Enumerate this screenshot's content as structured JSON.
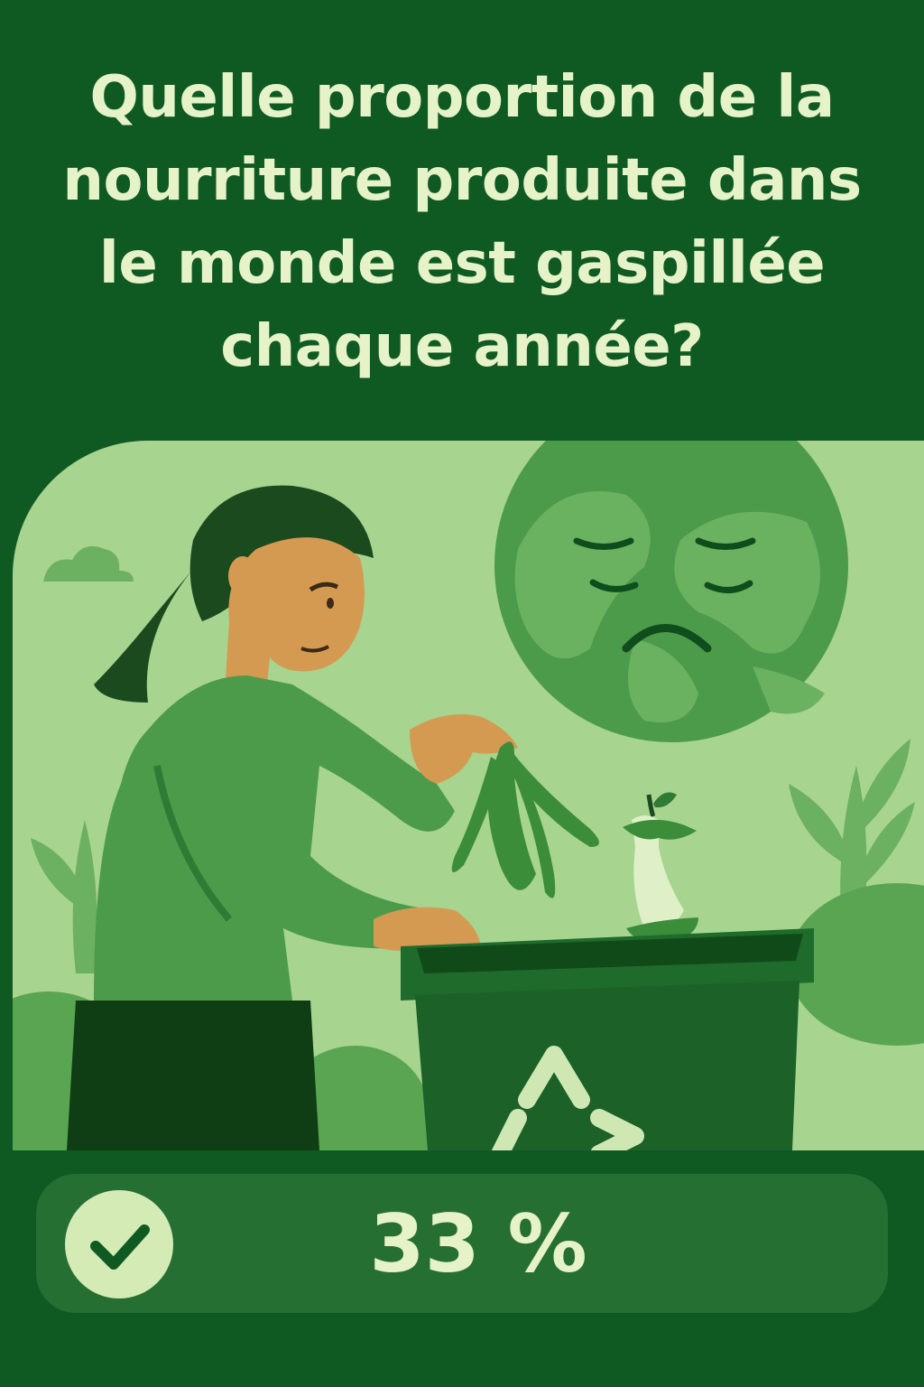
{
  "question": {
    "text": "Quelle proportion de la nourriture produite dans le monde est gaspillée chaque année?"
  },
  "illustration": {
    "icons": [
      "woman-figure",
      "sad-earth-icon",
      "banana-peel",
      "apple-core",
      "recycling-bin",
      "recycle-icon",
      "cloud-icon",
      "leaf-plant-icon"
    ]
  },
  "answer": {
    "icon": "check-icon",
    "value": "33 %"
  },
  "colors": {
    "background": "#0f5a23",
    "scene_background": "#a7d48f",
    "text": "#e6f2c7",
    "answer_panel": "#266f33",
    "badge": "#d4ebb6"
  }
}
